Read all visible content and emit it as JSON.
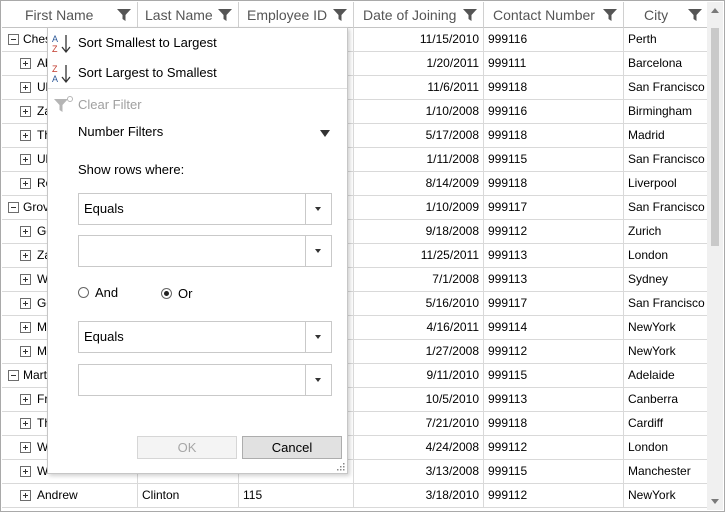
{
  "columns": [
    "First Name",
    "Last Name",
    "Employee ID",
    "Date of Joining",
    "Contact Number",
    "City"
  ],
  "rows": [
    {
      "type": "group",
      "first": "Ches",
      "last": "",
      "id": "",
      "date": "11/15/2010",
      "contact": "999116",
      "city": "Perth"
    },
    {
      "type": "item",
      "first": "Ab",
      "last": "",
      "id": "",
      "date": "1/20/2011",
      "contact": "999111",
      "city": "Barcelona"
    },
    {
      "type": "item",
      "first": "Ul",
      "last": "",
      "id": "",
      "date": "11/6/2011",
      "contact": "999118",
      "city": "San Francisco"
    },
    {
      "type": "item",
      "first": "Za",
      "last": "",
      "id": "",
      "date": "1/10/2008",
      "contact": "999116",
      "city": "Birmingham"
    },
    {
      "type": "item",
      "first": "Th",
      "last": "",
      "id": "",
      "date": "5/17/2008",
      "contact": "999118",
      "city": "Madrid"
    },
    {
      "type": "item",
      "first": "Ul",
      "last": "",
      "id": "",
      "date": "1/11/2008",
      "contact": "999115",
      "city": "San Francisco"
    },
    {
      "type": "item",
      "first": "Ro",
      "last": "",
      "id": "",
      "date": "8/14/2009",
      "contact": "999118",
      "city": "Liverpool"
    },
    {
      "type": "group",
      "first": "Grov",
      "last": "",
      "id": "",
      "date": "1/10/2009",
      "contact": "999117",
      "city": "San Francisco"
    },
    {
      "type": "item",
      "first": "Ge",
      "last": "",
      "id": "",
      "date": "9/18/2008",
      "contact": "999112",
      "city": "Zurich"
    },
    {
      "type": "item",
      "first": "Za",
      "last": "",
      "id": "",
      "date": "11/25/2011",
      "contact": "999113",
      "city": "London"
    },
    {
      "type": "item",
      "first": "W",
      "last": "",
      "id": "",
      "date": "7/1/2008",
      "contact": "999113",
      "city": "Sydney"
    },
    {
      "type": "item",
      "first": "Ge",
      "last": "",
      "id": "",
      "date": "5/16/2010",
      "contact": "999117",
      "city": "San Francisco"
    },
    {
      "type": "item",
      "first": "M",
      "last": "",
      "id": "",
      "date": "4/16/2011",
      "contact": "999114",
      "city": "NewYork"
    },
    {
      "type": "item",
      "first": "M",
      "last": "",
      "id": "",
      "date": "1/27/2008",
      "contact": "999112",
      "city": "NewYork"
    },
    {
      "type": "group",
      "first": "Mart",
      "last": "",
      "id": "",
      "date": "9/11/2010",
      "contact": "999115",
      "city": "Adelaide"
    },
    {
      "type": "item",
      "first": "Fr",
      "last": "",
      "id": "",
      "date": "10/5/2010",
      "contact": "999113",
      "city": "Canberra"
    },
    {
      "type": "item",
      "first": "Th",
      "last": "",
      "id": "",
      "date": "7/21/2010",
      "contact": "999118",
      "city": "Cardiff"
    },
    {
      "type": "item",
      "first": "W",
      "last": "",
      "id": "",
      "date": "4/24/2008",
      "contact": "999112",
      "city": "London"
    },
    {
      "type": "item",
      "first": "W",
      "last": "",
      "id": "",
      "date": "3/13/2008",
      "contact": "999115",
      "city": "Manchester"
    },
    {
      "type": "item",
      "first": "Andrew",
      "last": "Clinton",
      "id": "115",
      "date": "3/18/2010",
      "contact": "999112",
      "city": "NewYork"
    }
  ],
  "filter_popup": {
    "sort_asc": "Sort Smallest to Largest",
    "sort_desc": "Sort Largest to Smallest",
    "clear_filter": "Clear Filter",
    "number_filters": "Number Filters",
    "show_rows_where": "Show rows where:",
    "condition1": "Equals",
    "value1": "",
    "radio_and": "And",
    "radio_or": "Or",
    "selected_operator": "Or",
    "condition2": "Equals",
    "value2": "",
    "ok": "OK",
    "cancel": "Cancel"
  },
  "colors": {
    "accent": "#2b5797",
    "icon": "#555555",
    "grid_line": "#d9d9d9"
  },
  "icons": {
    "filter": "filter-icon",
    "sort_asc": "sort-ascending-icon",
    "sort_desc": "sort-descending-icon",
    "clear_filter": "clear-filter-icon"
  }
}
